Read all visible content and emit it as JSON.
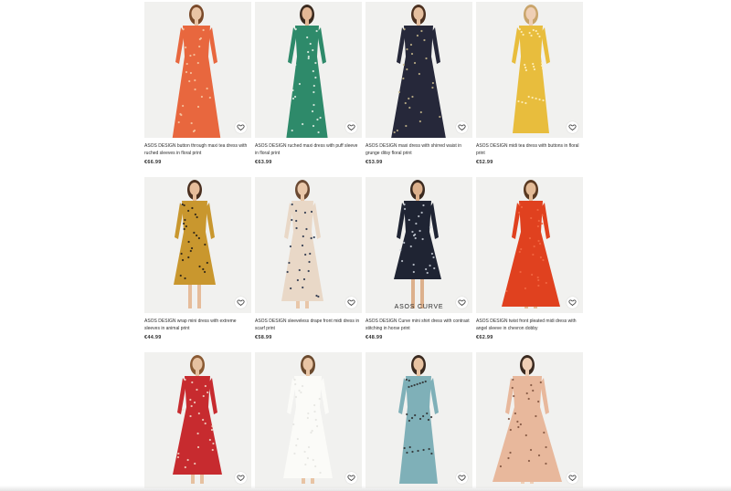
{
  "products": [
    {
      "title": "ASOS DESIGN button through maxi tea dress with ruched sleeves in floral print",
      "price": "€66.99",
      "dress_color": "#e8673e",
      "pattern_color": "#f7c9a4",
      "skin": "#e9c4a5",
      "hair": "#7a4a2a"
    },
    {
      "title": "ASOS DESIGN ruched maxi dress with puff sleeve in floral print",
      "price": "€63.99",
      "dress_color": "#2e8a6a",
      "pattern_color": "#e9f2ea",
      "skin": "#e3b896",
      "hair": "#3a2a1f"
    },
    {
      "title": "ASOS DESIGN maxi dress with shirred waist in grunge ditsy floral print",
      "price": "€53.99",
      "dress_color": "#26283a",
      "pattern_color": "#c8b98d",
      "skin": "#e5bf9f",
      "hair": "#4b3020"
    },
    {
      "title": "ASOS DESIGN midi tea dress with buttons in floral print",
      "price": "€52.99",
      "dress_color": "#e8bd3d",
      "pattern_color": "#fff2c4",
      "skin": "#efcfb5",
      "hair": "#c9a56b"
    },
    {
      "title": "ASOS DESIGN wrap mini dress with extreme sleeves in animal print",
      "price": "€44.99",
      "dress_color": "#c9972e",
      "pattern_color": "#1f1a16",
      "skin": "#e6bc9a",
      "hair": "#4a2f1f"
    },
    {
      "title": "ASOS DESIGN sleeveless drape front midi dress in scarf print",
      "price": "€58.99",
      "dress_color": "#e9d8c7",
      "pattern_color": "#1e2b44",
      "skin": "#e9c7a9",
      "hair": "#6b4a33"
    },
    {
      "title": "ASOS DESIGN Curve mini shirt dress with contrast stitching in horse print",
      "price": "€48.99",
      "dress_color": "#1f2433",
      "pattern_color": "#c9cfd8",
      "skin": "#dcb08c",
      "hair": "#3b2a20",
      "badge": "ASOS CURVE"
    },
    {
      "title": "ASOS DESIGN twist front pleated midi dress with angel sleeve in chevron dobby",
      "price": "€62.99",
      "dress_color": "#e0411f",
      "pattern_color": "#f26a44",
      "skin": "#e3bb97",
      "hair": "#5a3a22"
    },
    {
      "title": "",
      "price": "",
      "dress_color": "#c72b2f",
      "pattern_color": "#f2d9c9",
      "skin": "#e6c1a0",
      "hair": "#8a5a33"
    },
    {
      "title": "",
      "price": "",
      "dress_color": "#fbfbf8",
      "pattern_color": "#e4e4e0",
      "skin": "#e8c4a4",
      "hair": "#6b4a2e"
    },
    {
      "title": "",
      "price": "",
      "dress_color": "#7fb0b8",
      "pattern_color": "#2a2a2a",
      "skin": "#e8c3a2",
      "hair": "#3a2a20"
    },
    {
      "title": "",
      "price": "",
      "dress_color": "#e8b89c",
      "pattern_color": "#7a4e3a",
      "skin": "#efcfb6",
      "hair": "#3a2a20"
    }
  ],
  "icons": {
    "wishlist": "heart-icon"
  }
}
